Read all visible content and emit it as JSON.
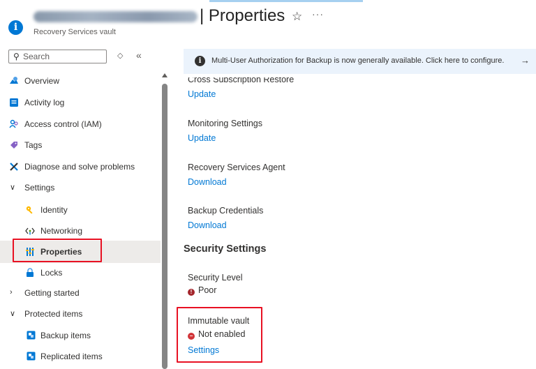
{
  "header": {
    "vault_name_redacted": "rsv-dev-backup-eastus",
    "title": "| Properties",
    "subtitle": "Recovery Services vault",
    "star_icon": "star-icon",
    "more_icon": "more-icon"
  },
  "nav": {
    "search_placeholder": "Search",
    "collapse_ctrl_1": "◇",
    "collapse_ctrl_2": "«",
    "items": [
      {
        "label": "Overview",
        "icon": "overview-icon"
      },
      {
        "label": "Activity log",
        "icon": "activity-log-icon"
      },
      {
        "label": "Access control (IAM)",
        "icon": "iam-icon"
      },
      {
        "label": "Tags",
        "icon": "tag-icon"
      },
      {
        "label": "Diagnose and solve problems",
        "icon": "wrench-icon"
      },
      {
        "label": "Settings",
        "icon": "chevron-down-icon"
      },
      {
        "label": "Identity",
        "icon": "key-icon"
      },
      {
        "label": "Networking",
        "icon": "networking-icon"
      },
      {
        "label": "Properties",
        "icon": "properties-icon",
        "selected": true
      },
      {
        "label": "Locks",
        "icon": "lock-icon"
      },
      {
        "label": "Getting started",
        "icon": "chevron-right-icon"
      },
      {
        "label": "Protected items",
        "icon": "chevron-down-icon"
      },
      {
        "label": "Backup items",
        "icon": "backup-items-icon"
      },
      {
        "label": "Replicated items",
        "icon": "replicated-items-icon"
      }
    ]
  },
  "banner": {
    "message": "Multi-User Authorization for Backup is now generally available. Click here to configure.",
    "arrow": "→"
  },
  "content": {
    "cross_sub_label": "Cross Subscription Restore",
    "cross_sub_link": "Update",
    "monitoring_label": "Monitoring Settings",
    "monitoring_link": "Update",
    "agent_label": "Recovery Services Agent",
    "agent_link": "Download",
    "credentials_label": "Backup Credentials",
    "credentials_link": "Download",
    "security_heading": "Security Settings",
    "security_level_label": "Security Level",
    "security_level_value": "Poor",
    "immutable_label": "Immutable vault",
    "immutable_value": "Not enabled",
    "immutable_link": "Settings"
  },
  "colors": {
    "accent": "#0078d4",
    "highlight": "#e81123",
    "poor": "#a4262c",
    "not_enabled": "#d13438",
    "banner_bg": "#ebf3fc"
  }
}
